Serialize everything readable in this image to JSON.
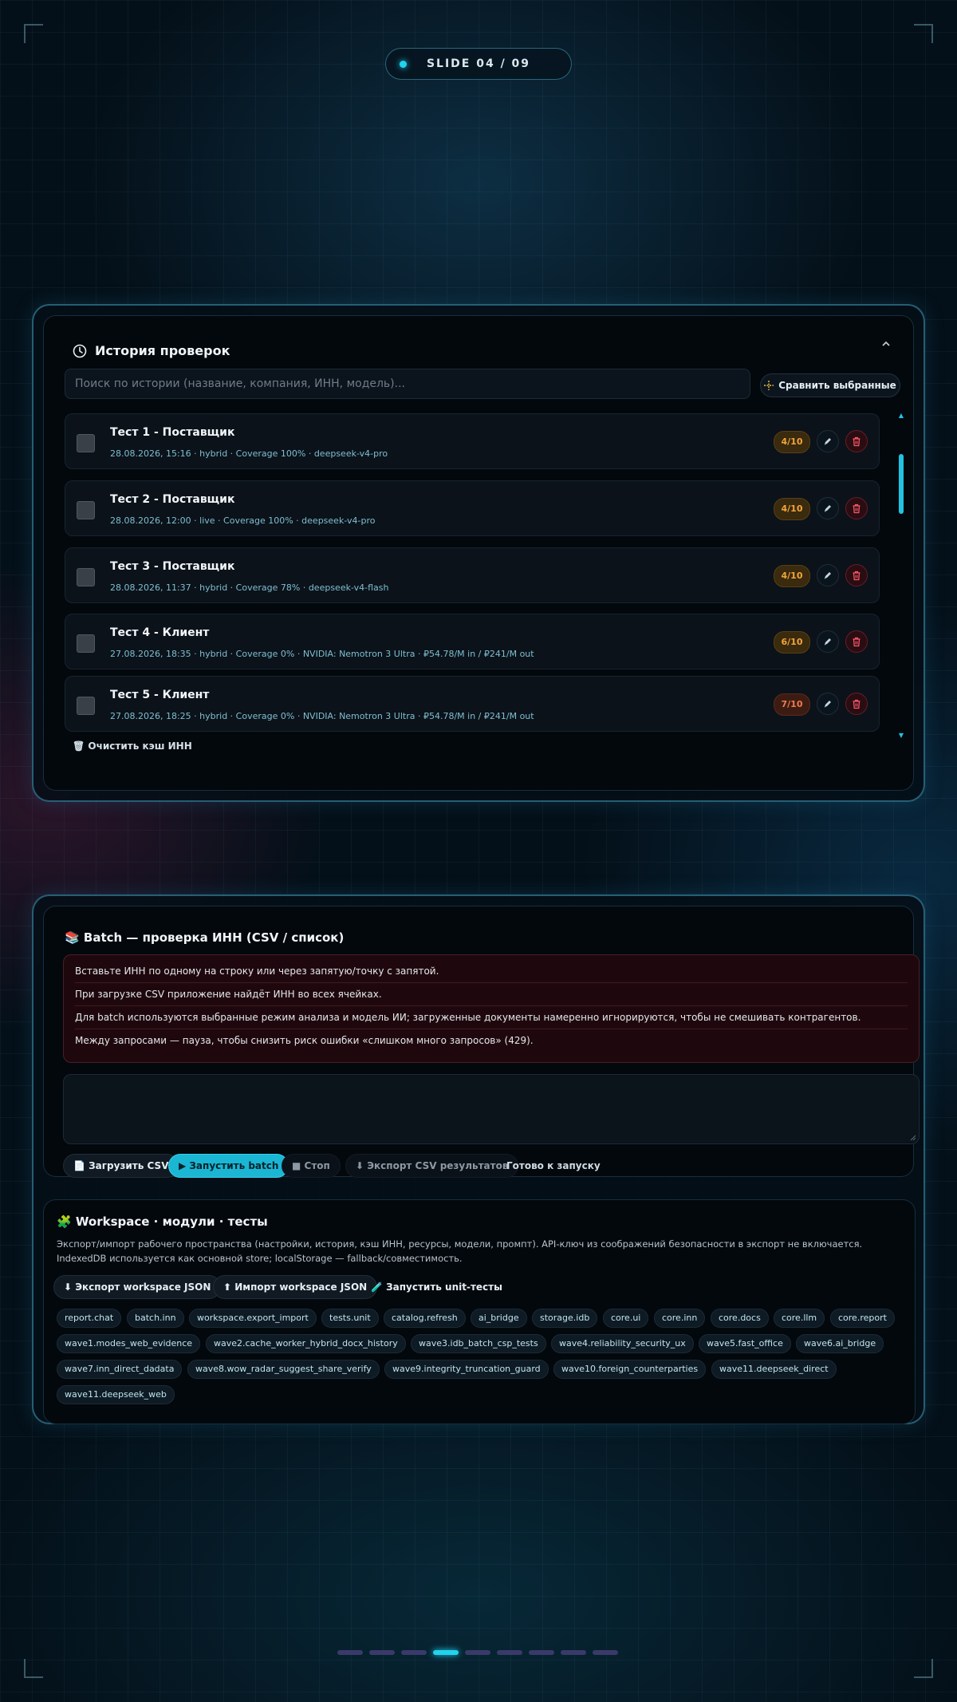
{
  "slide": {
    "label": "SLIDE  04 / 09"
  },
  "history": {
    "title": "История проверок",
    "search_placeholder": "Поиск по истории (название, компания, ИНН, модель)...",
    "compare_label": "Сравнить выбранные",
    "rows": [
      {
        "title": "Тест 1 - Поставщик",
        "meta": "28.08.2026, 15:16 · hybrid · Coverage 100% · deepseek-v4-pro",
        "score": "4/10",
        "score_color": "#f2a53a"
      },
      {
        "title": "Тест 2 - Поставщик",
        "meta": "28.08.2026, 12:00 · live · Coverage 100% · deepseek-v4-pro",
        "score": "4/10",
        "score_color": "#f2a53a"
      },
      {
        "title": "Тест 3 - Поставщик",
        "meta": "28.08.2026, 11:37 · hybrid · Coverage 78% · deepseek-v4-flash",
        "score": "4/10",
        "score_color": "#f2a53a"
      },
      {
        "title": "Тест 4 - Клиент",
        "meta": "27.08.2026, 18:35 · hybrid · Coverage 0% · NVIDIA: Nemotron 3 Ultra · ₽54.78/M in / ₽241/M out",
        "score": "6/10",
        "score_color": "#f2a53a"
      },
      {
        "title": "Тест 5 - Клиент",
        "meta": "27.08.2026, 18:25 · hybrid · Coverage 0% · NVIDIA: Nemotron 3 Ultra · ₽54.78/M in / ₽241/M out",
        "score": "7/10",
        "score_color": "#f07a50"
      }
    ],
    "clear_cache_label": "🗑 Очистить кэш ИНН"
  },
  "batch": {
    "title": "📚 Batch — проверка ИНН (CSV / список)",
    "info": [
      "Вставьте ИНН по одному на строку или через запятую/точку с запятой.",
      "При загрузке CSV приложение найдёт ИНН во всех ячейках.",
      "Для batch используются выбранные режим анализа и модель ИИ; загруженные документы намеренно игнорируются, чтобы не смешивать контрагентов.",
      "Между запросами — пауза, чтобы снизить риск ошибки «слишком много запросов» (429)."
    ],
    "upload_csv": "📄 Загрузить CSV",
    "run_batch": "▶ Запустить batch",
    "stop": "■ Стоп",
    "export_csv": "⬇ Экспорт CSV результатов",
    "status": "Готово к запуску"
  },
  "workspace": {
    "title": "🧩 Workspace · модули · тесты",
    "description": "Экспорт/импорт рабочего пространства (настройки, история, кэш ИНН, ресурсы, модели, промпт). API-ключ из соображений безопасности в экспорт не включается. IndexedDB используется как основной store; localStorage — fallback/совместимость.",
    "export_json": "⬇ Экспорт workspace JSON",
    "import_json": "⬆ Импорт workspace JSON",
    "run_tests": "🧪 Запустить unit-тесты",
    "modules": [
      "report.chat",
      "batch.inn",
      "workspace.export_import",
      "tests.unit",
      "catalog.refresh",
      "ai_bridge",
      "storage.idb",
      "core.ui",
      "core.inn",
      "core.docs",
      "core.llm",
      "core.report",
      "wave1.modes_web_evidence",
      "wave2.cache_worker_hybrid_docx_history",
      "wave3.idb_batch_csp_tests",
      "wave4.reliability_security_ux",
      "wave5.fast_office",
      "wave6.ai_bridge",
      "wave7.inn_direct_dadata",
      "wave8.wow_radar_suggest_share_verify",
      "wave9.integrity_truncation_guard",
      "wave10.foreign_counterparties",
      "wave11.deepseek_direct",
      "wave11.deepseek_web"
    ]
  },
  "pager": {
    "count": 9,
    "active": 4
  }
}
